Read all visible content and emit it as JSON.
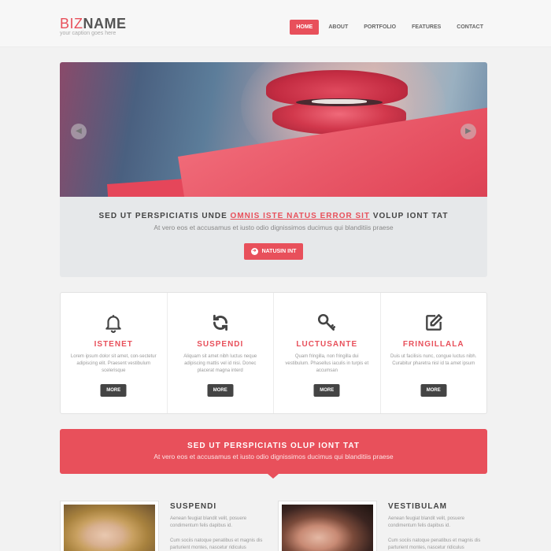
{
  "header": {
    "logo_prefix": "BIZ",
    "logo_suffix": "NAME",
    "tagline": "your caption goes here",
    "nav": [
      "HOME",
      "ABOUT",
      "PORTFOLIO",
      "FEATURES",
      "CONTACT"
    ],
    "active_nav": "HOME"
  },
  "slider": {
    "title_before": "SED UT PERSPICIATIS UNDE ",
    "title_highlight": "OMNIS ISTE NATUS ERROR SIT",
    "title_after": " VOLUP IONT TAT",
    "subtitle": "At vero eos et accusamus et iusto odio dignissimos ducimus qui blanditiis praese",
    "cta_label": "NATUSIN INT",
    "prev_icon": "arrow-left-icon",
    "next_icon": "arrow-right-icon"
  },
  "features": [
    {
      "icon": "bell-icon",
      "title": "ISTENET",
      "text": "Lorem ipsum dolor sit amet, con-sectetur adipiscing elit. Praesent vestibulum scelerisque",
      "more": "MORE"
    },
    {
      "icon": "refresh-icon",
      "title": "SUSPENDI",
      "text": "Aliquam sit amet nibh luctus neque adipiscing mattis vel id nisi. Donec placerat magna interd",
      "more": "MORE"
    },
    {
      "icon": "key-icon",
      "title": "LUCTUSANTE",
      "text": "Quam fringilla, non fringilla dui vestibulum. Phasellus iaculis in turpis et accumsan",
      "more": "MORE"
    },
    {
      "icon": "edit-icon",
      "title": "FRINGILLALA",
      "text": "Duis ut facilisis nunc, congue luctus nibh. Curabitur pharetra nisl id ta amet ipsum",
      "more": "MORE"
    }
  ],
  "banner": {
    "title": "SED UT PERSPICIATIS OLUP IONT TAT",
    "subtitle": "At vero eos et accusamus et iusto odio dignissimos ducimus qui blanditiis praese"
  },
  "cards": [
    {
      "title": "SUSPENDI",
      "text": "Aenean feugiat blandit velit, posuere condimentum felis dapibus id.",
      "text2": "Cum sociis natoque penatibus et magnis dis parturient montes, nascetur ridiculus"
    },
    {
      "title": "VESTIBULAM",
      "text": "Aenean feugiat blandit velit, posuere condimentum felis dapibus id.",
      "text2": "Cum sociis natoque penatibus et magnis dis parturient montes, nascetur ridiculus"
    }
  ],
  "colors": {
    "accent": "#e8505b",
    "dark": "#444444",
    "muted": "#999999"
  }
}
